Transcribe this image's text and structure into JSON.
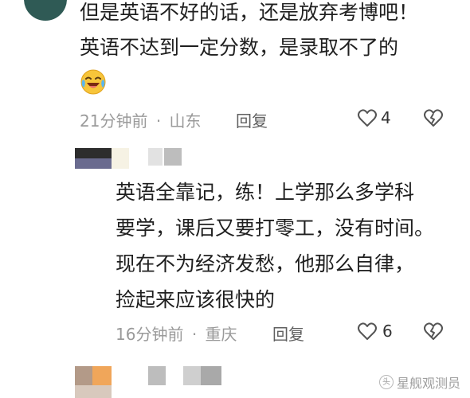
{
  "comment_1": {
    "lines": [
      "但是英语不好的话，还是放弃考博吧！",
      "英语不达到一定分数，是录取不了的"
    ],
    "time": "21分钟前",
    "separator": "·",
    "location": "山东",
    "reply_label": "回复",
    "likes": "4"
  },
  "comment_2": {
    "lines": [
      "英语全靠记，练！上学那么多学科",
      "要学，课后又要打零工，没有时间。",
      "现在不为经济发愁，他那么自律，",
      "捡起来应该很快的"
    ],
    "time": "16分钟前",
    "separator": "·",
    "location": "重庆",
    "reply_label": "回复",
    "likes": "6"
  },
  "watermark": {
    "text": "星舰观测员"
  },
  "icons": {
    "like": "heart-outline-icon",
    "dislike": "broken-heart-icon",
    "emoji": "laughing-crying-emoji"
  },
  "colors": {
    "text": "#1f1f1f",
    "meta": "#9a9a9a",
    "reply": "#5f5f5f",
    "icon": "#555555"
  }
}
